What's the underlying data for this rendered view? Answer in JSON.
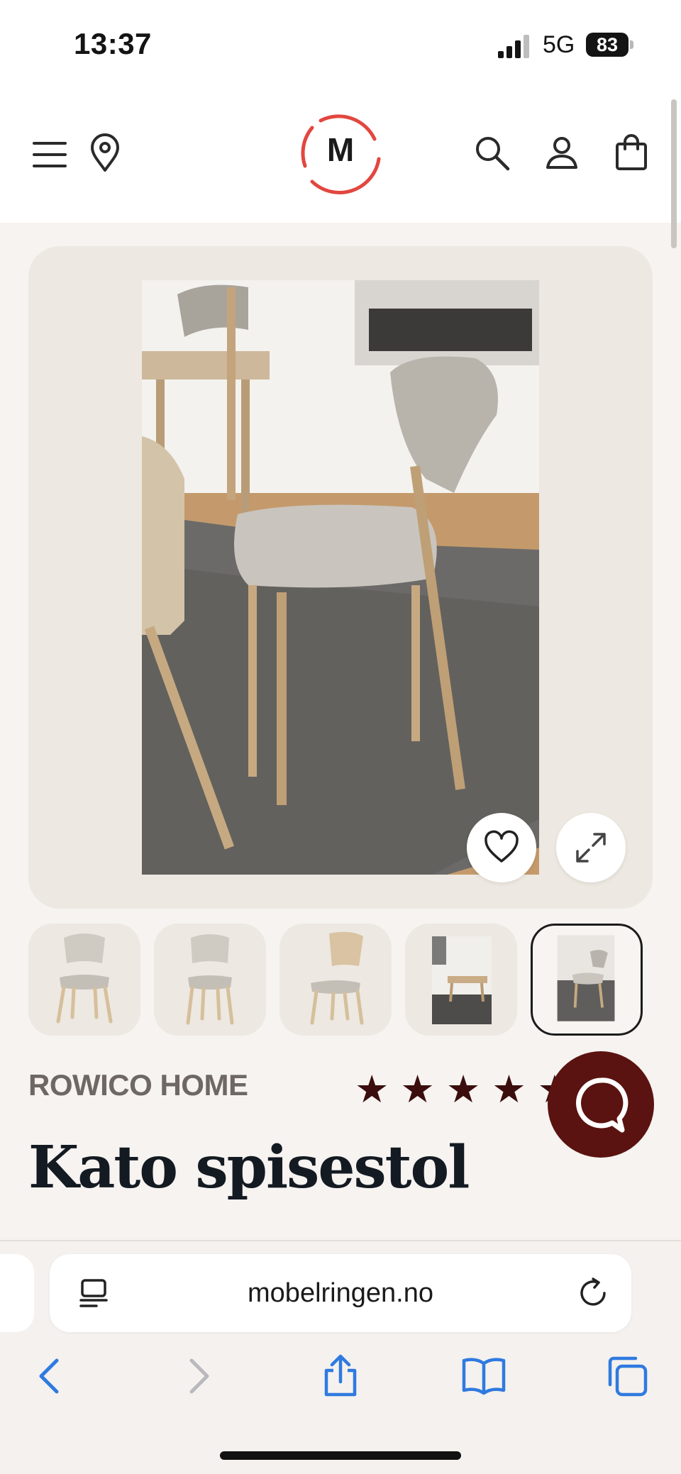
{
  "status": {
    "time": "13:37",
    "network": "5G",
    "battery": "83"
  },
  "header": {
    "logo_letter": "M"
  },
  "product": {
    "brand": "ROWICO HOME",
    "rating": "★★★★★",
    "title": "Kato spisestol",
    "thumbnail_count": 5,
    "active_thumbnail": 5
  },
  "browser": {
    "url": "mobelringen.no"
  },
  "colors": {
    "accent_red": "#e2473f",
    "chat_bg": "#5a1310",
    "star": "#3b0d0d",
    "ios_blue": "#2f7ae0"
  },
  "icons": {
    "menu": "menu-icon",
    "location": "location-pin-icon",
    "search": "search-icon",
    "account": "user-icon",
    "cart": "shopping-bag-icon",
    "favorite": "heart-icon",
    "expand": "expand-icon",
    "chat": "chat-icon",
    "reader": "reader-icon",
    "reload": "reload-icon",
    "back": "back-icon",
    "forward": "forward-icon",
    "share": "share-icon",
    "bookmarks": "bookmarks-icon",
    "tabs": "tabs-icon"
  }
}
